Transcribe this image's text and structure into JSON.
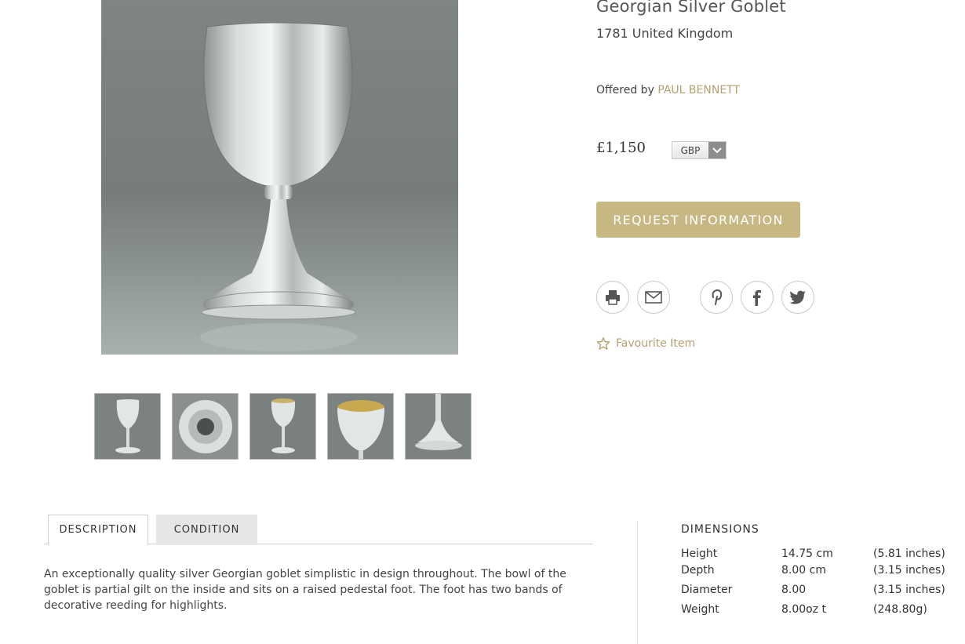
{
  "product": {
    "title": "Georgian Silver Goblet",
    "subtitle": "1781 United Kingdom",
    "offered_prefix": "Offered by",
    "dealer": "PAUL BENNETT",
    "price": "£1,150",
    "currency": "GBP",
    "request_button": "REQUEST INFORMATION",
    "favourite": "Favourite Item"
  },
  "social_icons": [
    "print-icon",
    "email-icon",
    "pinterest-icon",
    "facebook-icon",
    "twitter-icon"
  ],
  "thumbnails": [
    "goblet-front",
    "goblet-base-underside",
    "goblet-side",
    "goblet-interior-gilt",
    "goblet-foot-detail"
  ],
  "tabs": [
    {
      "label": "DESCRIPTION",
      "active": true
    },
    {
      "label": "CONDITION",
      "active": false
    }
  ],
  "description": "An exceptionally quality silver Georgian goblet simplistic in design throughout. The bowl of the goblet is partial gilt on the inside and sits on a raised pedestal foot. The foot has two bands of decorative reeding for highlights.",
  "dimensions": {
    "title": "DIMENSIONS",
    "rows": [
      {
        "label": "Height",
        "metric": "14.75 cm",
        "imperial": "(5.81 inches)"
      },
      {
        "label": "Depth",
        "metric": "8.00 cm",
        "imperial": "(3.15 inches)"
      },
      {
        "label": "Diameter",
        "metric": "8.00",
        "imperial": "(3.15 inches)"
      },
      {
        "label": "Weight",
        "metric": "8.00oz t",
        "imperial": "(248.80g)"
      }
    ]
  },
  "colors": {
    "accent_gold": "#c7b783",
    "link_gold": "#b3a16f",
    "tab_inactive": "#e6e6e6",
    "text": "#333333"
  }
}
